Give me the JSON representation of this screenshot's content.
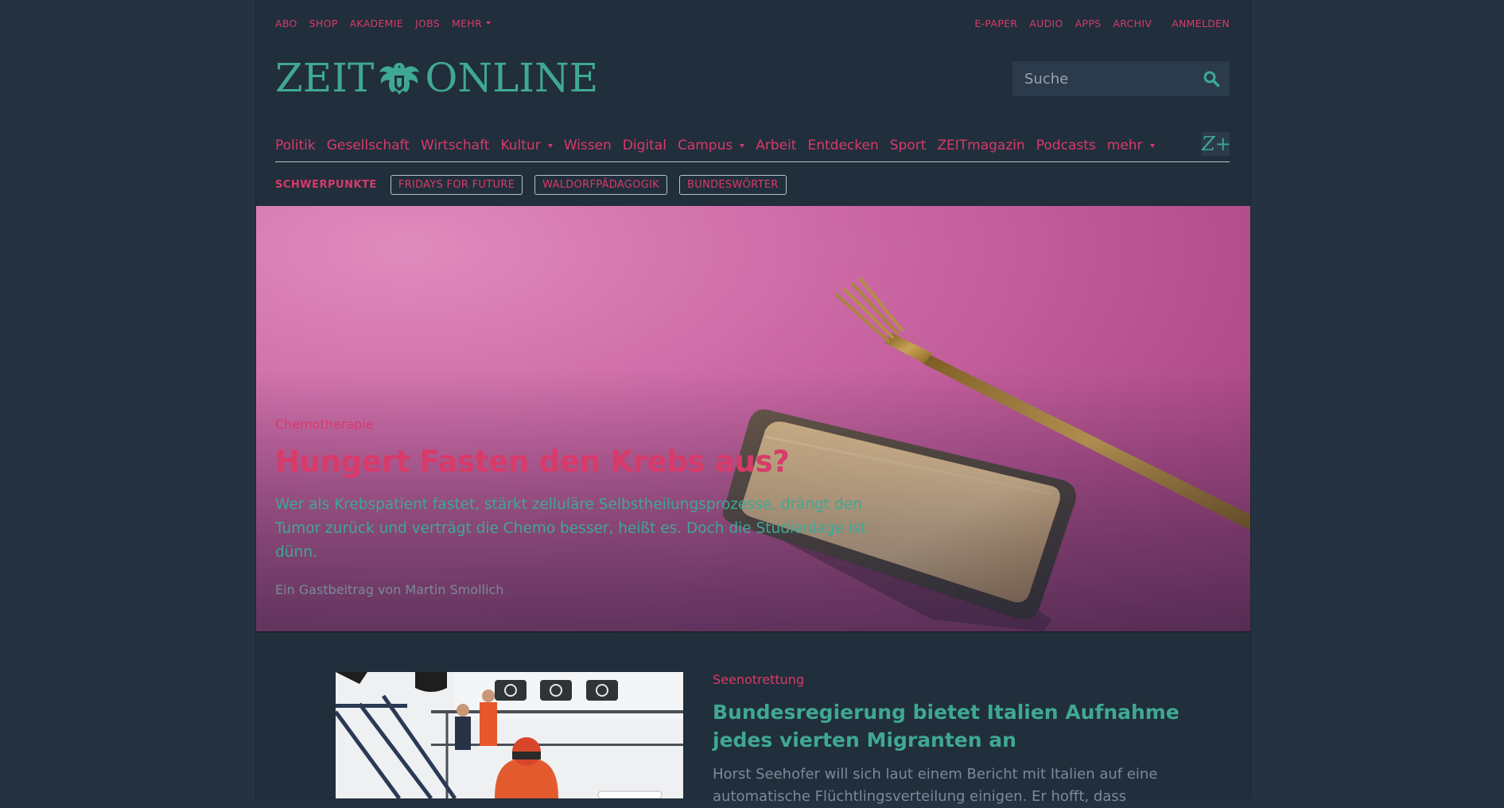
{
  "utility_nav": {
    "left": [
      "ABO",
      "SHOP",
      "AKADEMIE",
      "JOBS",
      "MEHR"
    ],
    "right": [
      "E-PAPER",
      "AUDIO",
      "APPS",
      "ARCHIV"
    ],
    "login": "ANMELDEN"
  },
  "logo": {
    "left_text": "ZEIT",
    "right_text": "ONLINE"
  },
  "search": {
    "placeholder": "Suche"
  },
  "main_nav": {
    "items": [
      "Politik",
      "Gesellschaft",
      "Wirtschaft",
      "Kultur",
      "Wissen",
      "Digital",
      "Campus",
      "Arbeit",
      "Entdecken",
      "Sport",
      "ZEITmagazin",
      "Podcasts",
      "mehr"
    ],
    "zplus": "Z+"
  },
  "topics": {
    "label": "SCHWERPUNKTE",
    "items": [
      "FRIDAYS FOR FUTURE",
      "WALDORFPÄDAGOGIK",
      "BUNDESWÖRTER"
    ]
  },
  "hero": {
    "kicker": "Chemotherapie",
    "title": "Hungert Fasten den Krebs aus?",
    "teaser": "Wer als Krebspatient fastet, stärkt zelluläre Selbstheilungsprozesse, drängt den Tumor zurück und verträgt die Chemo besser, heißt es. Doch die Studienlage ist dünn.",
    "byline": "Ein Gastbeitrag von Martin Smollich"
  },
  "article2": {
    "kicker": "Seenotrettung",
    "title": "Bundesregierung bietet Italien Aufnahme jedes vierten Migranten an",
    "teaser": "Horst Seehofer will sich laut einem Bericht mit Italien auf eine automatische Flüchtlingsverteilung einigen. Er hofft, dass"
  },
  "colors": {
    "accent": "#d83a6a",
    "brand": "#3fa894",
    "background": "#243241",
    "page": "#212e3b",
    "muted": "#7b8a99"
  },
  "icons": {
    "search": "search-icon",
    "eagle": "eagle-logo-icon",
    "caret": "chevron-down-icon"
  }
}
